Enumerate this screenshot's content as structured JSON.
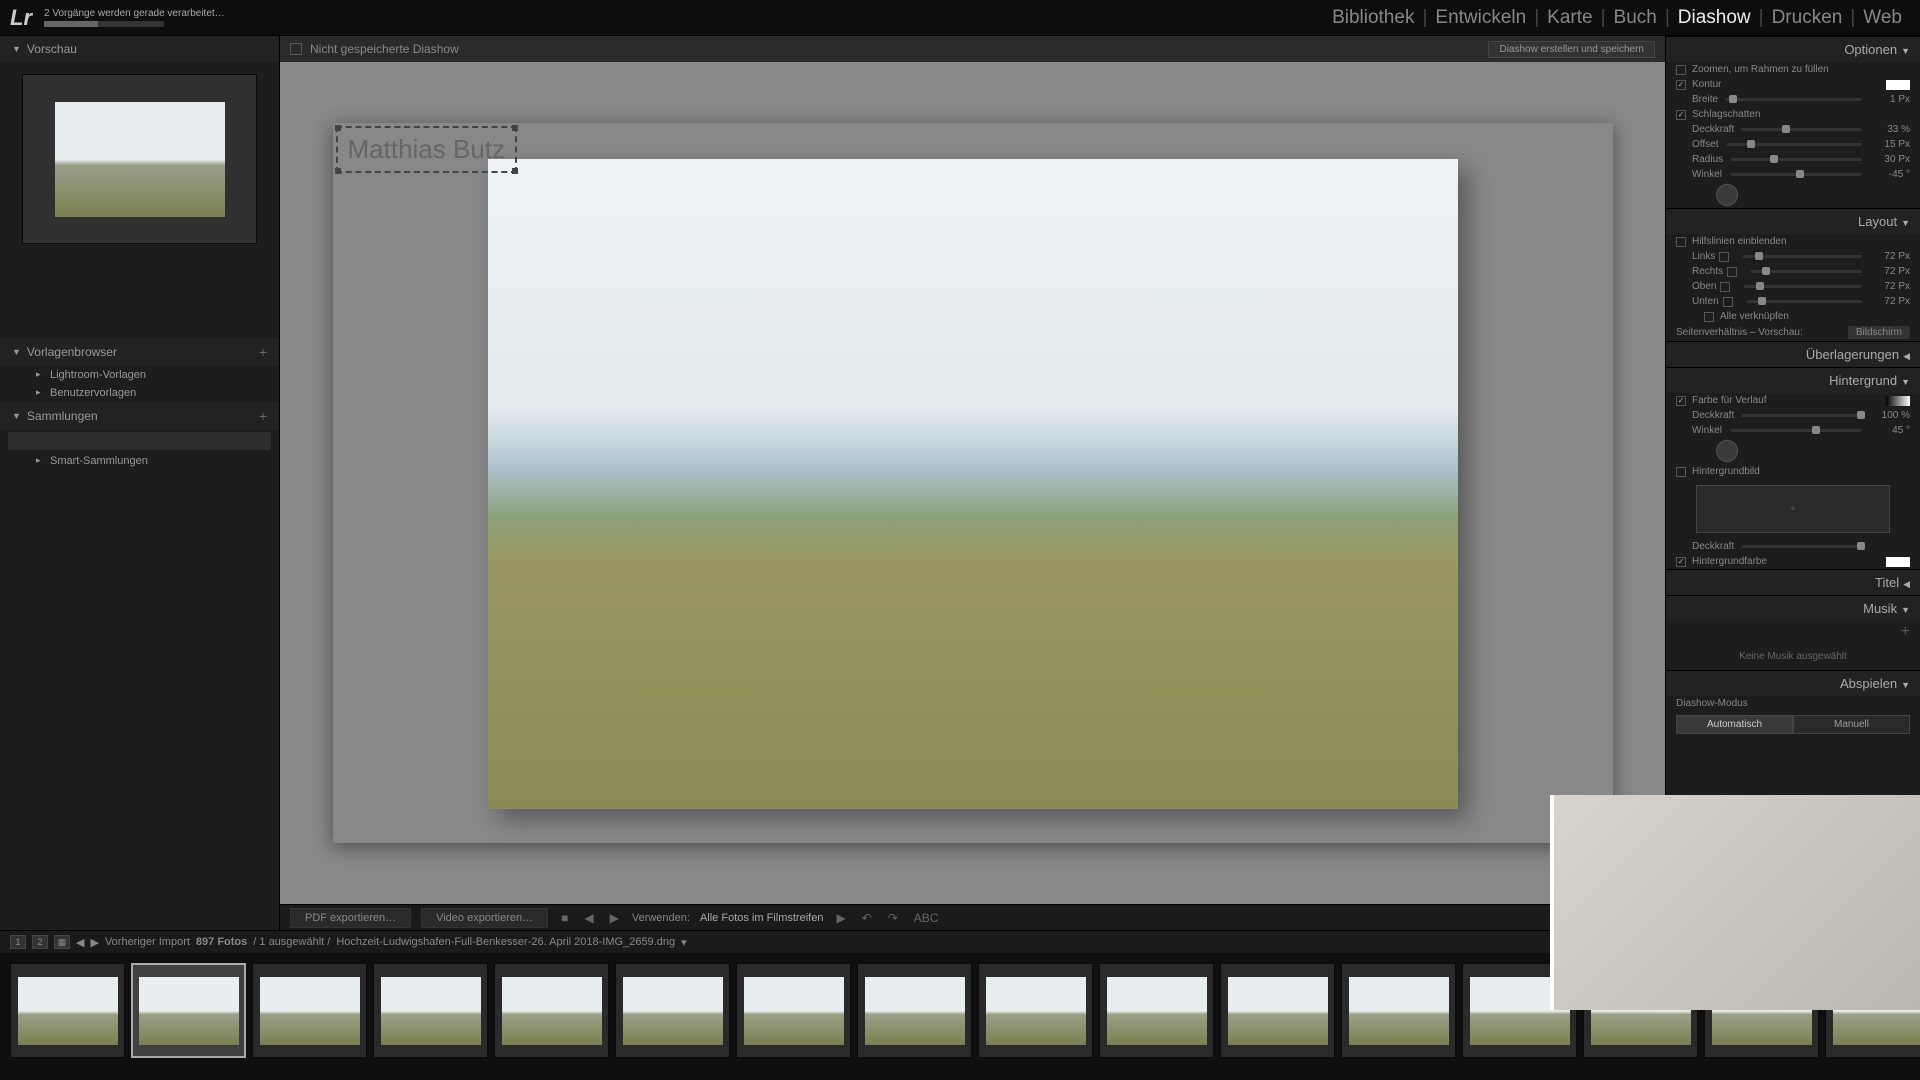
{
  "app": {
    "progress_text": "2 Vorgänge werden gerade verarbeitet…"
  },
  "nav": {
    "library": "Bibliothek",
    "develop": "Entwickeln",
    "map": "Karte",
    "book": "Buch",
    "slideshow": "Diashow",
    "print": "Drucken",
    "web": "Web"
  },
  "left": {
    "preview_header": "Vorschau",
    "templates_header": "Vorlagenbrowser",
    "template_lr": "Lightroom-Vorlagen",
    "template_user": "Benutzervorlagen",
    "collections_header": "Sammlungen",
    "smart_collections": "Smart-Sammlungen"
  },
  "center": {
    "title": "Nicht gespeicherte Diashow",
    "save_btn": "Diashow erstellen und speichern",
    "overlay_text": "Matthias Butz",
    "export_pdf": "PDF exportieren…",
    "export_video": "Video exportieren…",
    "use_label": "Verwenden:",
    "use_value": "Alle Fotos im Filmstreifen",
    "abc": "ABC"
  },
  "right": {
    "options_header": "Optionen",
    "zoom_fill": "Zoomen, um Rahmen zu füllen",
    "stroke": "Kontur",
    "width_label": "Breite",
    "width_val": "1 Px",
    "shadow": "Schlagschatten",
    "opacity_label": "Deckkraft",
    "opacity_val": "33 %",
    "offset_label": "Offset",
    "offset_val": "15 Px",
    "radius_label": "Radius",
    "radius_val": "30 Px",
    "angle_label": "Winkel",
    "angle_val": "-45 °",
    "layout_header": "Layout",
    "guides": "Hilfslinien einblenden",
    "left_label": "Links",
    "right_label": "Rechts",
    "top_label": "Oben",
    "bottom_label": "Unten",
    "guide_val": "72 Px",
    "link_all": "Alle verknüpfen",
    "aspect_label": "Seitenverhältnis – Vorschau:",
    "aspect_val": "Bildschirm",
    "overlays_header": "Überlagerungen",
    "background_header": "Hintergrund",
    "color_gradient": "Farbe für Verlauf",
    "bg_opacity_val": "100 %",
    "bg_angle_val": "45 °",
    "bg_image": "Hintergrundbild",
    "bg_color": "Hintergrundfarbe",
    "opacity2_label": "Deckkraft",
    "title_header": "Titel",
    "music_header": "Musik",
    "no_music": "Keine Musik ausgewählt",
    "playback_header": "Abspielen",
    "mode_label": "Diashow-Modus",
    "mode_auto": "Automatisch",
    "mode_manual": "Manuell"
  },
  "filmstrip": {
    "prev_import": "Vorheriger Import",
    "count": "897 Fotos",
    "selected": "/ 1 ausgewählt /",
    "path": "Hochzeit-Ludwigshafen-Full-Benkesser-26. April 2018-IMG_2659.dng"
  }
}
